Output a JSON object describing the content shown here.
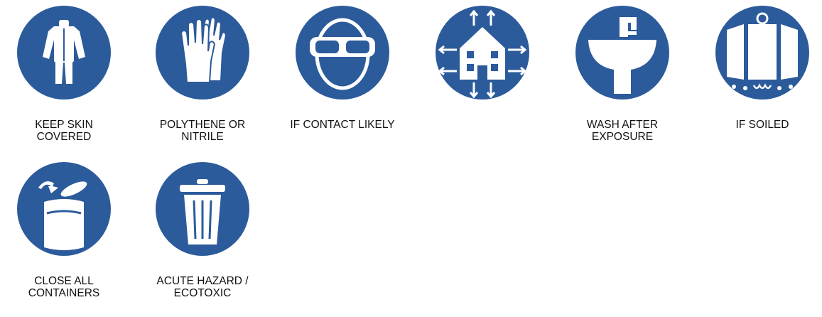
{
  "colors": {
    "sign_blue": "#2c5b9b",
    "symbol": "#ffffff",
    "text": "#111111"
  },
  "signs": [
    {
      "icon": "protective-suit-icon",
      "caption": "KEEP SKIN\nCOVERED"
    },
    {
      "icon": "gloves-icon",
      "caption": "POLYTHENE OR\nNITRILE"
    },
    {
      "icon": "goggles-icon",
      "caption": "IF CONTACT LIKELY"
    },
    {
      "icon": "ventilate-building-icon",
      "caption": ""
    },
    {
      "icon": "wash-basin-icon",
      "caption": "WASH AFTER\nEXPOSURE"
    },
    {
      "icon": "change-clothes-icon",
      "caption": "IF SOILED"
    },
    {
      "icon": "close-container-icon",
      "caption": "CLOSE ALL\nCONTAINERS"
    },
    {
      "icon": "waste-bin-icon",
      "caption": "ACUTE HAZARD /\nECOTOXIC"
    }
  ]
}
